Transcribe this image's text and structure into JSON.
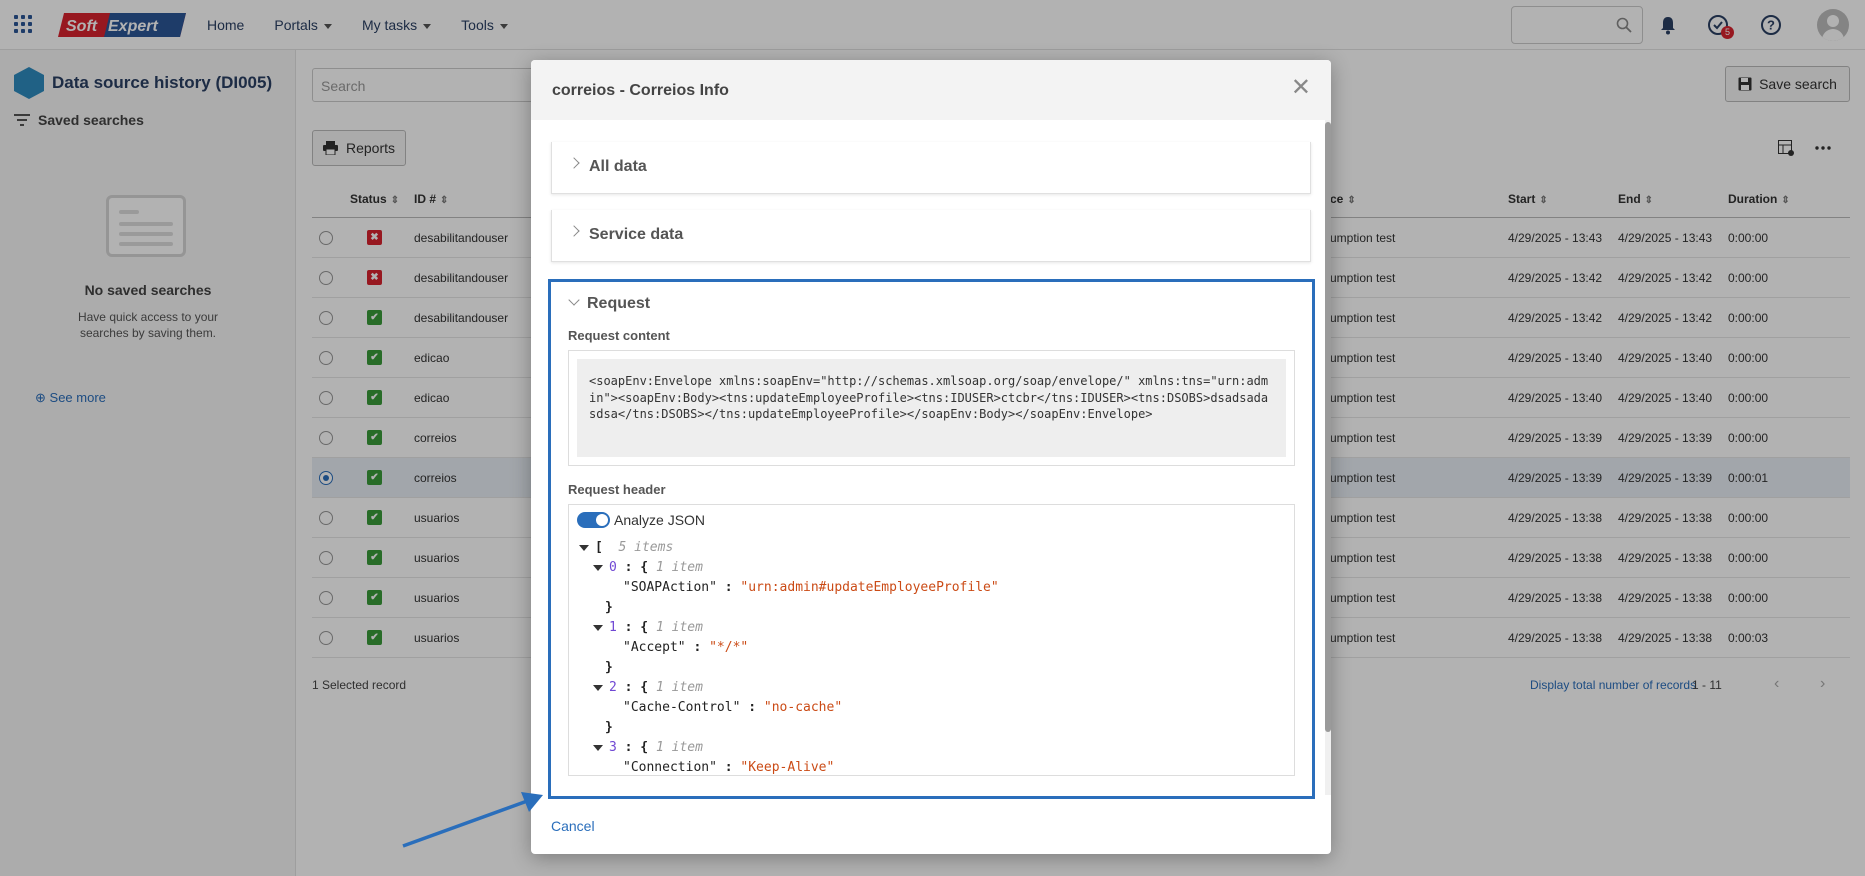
{
  "nav": {
    "home": "Home",
    "portals": "Portals",
    "my_tasks": "My tasks",
    "tools": "Tools"
  },
  "logo": {
    "text": "SoftExpert"
  },
  "notifications": {
    "badge": "5"
  },
  "sidebar": {
    "title": "Data source history (DI005)",
    "saved_searches": "Saved searches",
    "empty_title": "No saved searches",
    "empty_desc": "Have quick access to your searches by saving them.",
    "see_more": "See more"
  },
  "main": {
    "search_placeholder": "Search",
    "save_search": "Save search",
    "reports": "Reports"
  },
  "table": {
    "headers": {
      "status": "Status",
      "id": "ID #",
      "source": "ce",
      "start": "Start",
      "end": "End",
      "duration": "Duration"
    },
    "rows": [
      {
        "status": "error",
        "id": "desabilitandouser",
        "source": "umption test",
        "start": "4/29/2025 - 13:43",
        "end": "4/29/2025 - 13:43",
        "duration": "0:00:00",
        "selected": false
      },
      {
        "status": "error",
        "id": "desabilitandouser",
        "source": "umption test",
        "start": "4/29/2025 - 13:42",
        "end": "4/29/2025 - 13:42",
        "duration": "0:00:00",
        "selected": false
      },
      {
        "status": "ok",
        "id": "desabilitandouser",
        "source": "umption test",
        "start": "4/29/2025 - 13:42",
        "end": "4/29/2025 - 13:42",
        "duration": "0:00:00",
        "selected": false
      },
      {
        "status": "ok",
        "id": "edicao",
        "source": "umption test",
        "start": "4/29/2025 - 13:40",
        "end": "4/29/2025 - 13:40",
        "duration": "0:00:00",
        "selected": false
      },
      {
        "status": "ok",
        "id": "edicao",
        "source": "umption test",
        "start": "4/29/2025 - 13:40",
        "end": "4/29/2025 - 13:40",
        "duration": "0:00:00",
        "selected": false
      },
      {
        "status": "ok",
        "id": "correios",
        "source": "umption test",
        "start": "4/29/2025 - 13:39",
        "end": "4/29/2025 - 13:39",
        "duration": "0:00:00",
        "selected": false
      },
      {
        "status": "ok",
        "id": "correios",
        "source": "umption test",
        "start": "4/29/2025 - 13:39",
        "end": "4/29/2025 - 13:39",
        "duration": "0:00:01",
        "selected": true
      },
      {
        "status": "ok",
        "id": "usuarios",
        "source": "umption test",
        "start": "4/29/2025 - 13:38",
        "end": "4/29/2025 - 13:38",
        "duration": "0:00:00",
        "selected": false
      },
      {
        "status": "ok",
        "id": "usuarios",
        "source": "umption test",
        "start": "4/29/2025 - 13:38",
        "end": "4/29/2025 - 13:38",
        "duration": "0:00:00",
        "selected": false
      },
      {
        "status": "ok",
        "id": "usuarios",
        "source": "umption test",
        "start": "4/29/2025 - 13:38",
        "end": "4/29/2025 - 13:38",
        "duration": "0:00:00",
        "selected": false
      },
      {
        "status": "ok",
        "id": "usuarios",
        "source": "umption test",
        "start": "4/29/2025 - 13:38",
        "end": "4/29/2025 - 13:38",
        "duration": "0:00:03",
        "selected": false
      }
    ],
    "selected_count": "1 Selected record",
    "display_total": "Display total number of records",
    "range": "1 - 11"
  },
  "modal": {
    "title": "correios - Correios Info",
    "sections": {
      "all_data": "All data",
      "service_data": "Service data",
      "request": "Request"
    },
    "request_content_label": "Request content",
    "request_content": "<soapEnv:Envelope xmlns:soapEnv=\"http://schemas.xmlsoap.org/soap/envelope/\" xmlns:tns=\"urn:admin\"><soapEnv:Body><tns:updateEmployeeProfile><tns:IDUSER>ctcbr</tns:IDUSER><tns:DSOBS>dsadsadasdsa</tns:DSOBS></tns:updateEmployeeProfile></soapEnv:Body></soapEnv:Envelope>",
    "request_header_label": "Request header",
    "analyze_json": "Analyze JSON",
    "json": {
      "root_count": "5 items",
      "entries": [
        {
          "index": "0",
          "count": "1 item",
          "key": "\"SOAPAction\"",
          "value": "\"urn:admin#updateEmployeeProfile\""
        },
        {
          "index": "1",
          "count": "1 item",
          "key": "\"Accept\"",
          "value": "\"*/*\""
        },
        {
          "index": "2",
          "count": "1 item",
          "key": "\"Cache-Control\"",
          "value": "\"no-cache\""
        },
        {
          "index": "3",
          "count": "1 item",
          "key": "\"Connection\"",
          "value": "\"Keep-Alive\""
        }
      ]
    },
    "cancel": "Cancel"
  },
  "colors": {
    "accent": "#2a6ebb",
    "ok": "#3a9b3a",
    "error": "#d9232e"
  }
}
